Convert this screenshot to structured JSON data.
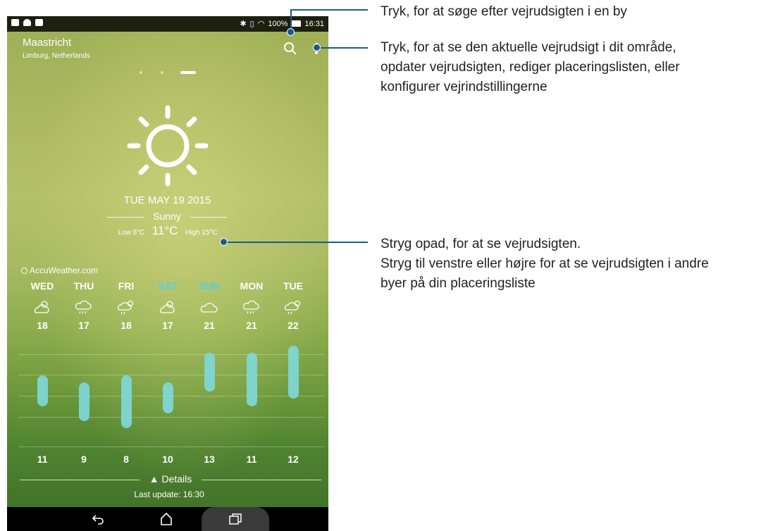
{
  "status_bar": {
    "battery": "100%",
    "time": "16:31"
  },
  "location": {
    "city": "Maastricht",
    "region": "Limburg, Netherlands"
  },
  "today": {
    "date": "TUE MAY 19 2015",
    "condition": "Sunny",
    "low": "Low 6°C",
    "current": "11°C",
    "high": "High 15°C",
    "icon": "sun-icon"
  },
  "provider": "AccuWeather.com",
  "forecast": [
    {
      "day": "WED",
      "high": "18",
      "low": "11",
      "icon": "partly-sunny-icon",
      "weekend": false
    },
    {
      "day": "THU",
      "high": "17",
      "low": "9",
      "icon": "rain-cloud-icon",
      "weekend": false
    },
    {
      "day": "FRI",
      "high": "18",
      "low": "8",
      "icon": "sun-rain-icon",
      "weekend": false
    },
    {
      "day": "SAT",
      "high": "17",
      "low": "10",
      "icon": "partly-sunny-icon",
      "weekend": true
    },
    {
      "day": "SUN",
      "high": "21",
      "low": "13",
      "icon": "cloud-icon",
      "weekend": true
    },
    {
      "day": "MON",
      "high": "21",
      "low": "11",
      "icon": "rain-cloud-icon",
      "weekend": false
    },
    {
      "day": "TUE",
      "high": "22",
      "low": "12",
      "icon": "sun-rain-icon",
      "weekend": false
    }
  ],
  "details_label": "Details",
  "last_update": "Last update: 16:30",
  "callouts": {
    "search": "Tryk, for at søge efter vejrudsigten i en by",
    "menu_lines": [
      "Tryk, for at se den aktuelle vejrudsigt i dit område,",
      "opdater vejrudsigten, rediger placeringslisten, eller",
      "konfigurer vejrindstillingerne"
    ],
    "swipe_lines": [
      "Stryg opad, for at se vejrudsigten.",
      "Stryg til venstre eller højre for at se vejrudsigten i andre",
      "byer på din placeringsliste"
    ]
  },
  "colors": {
    "callout": "#1a5b8c",
    "weekend": "#4fd0f0",
    "bar": "#7fd8d8"
  }
}
